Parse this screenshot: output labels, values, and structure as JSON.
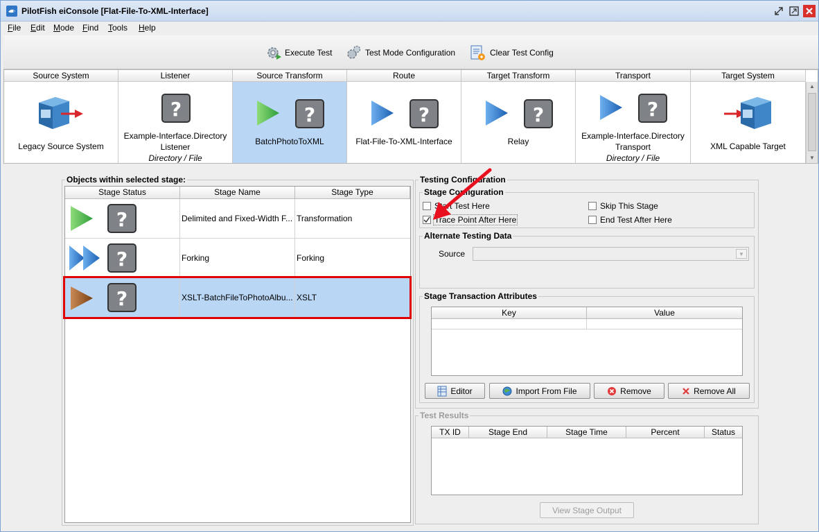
{
  "window": {
    "title": "PilotFish eiConsole [Flat-File-To-XML-Interface]"
  },
  "menu": [
    {
      "label": "File",
      "mnemonic": "F",
      "rest": "ile"
    },
    {
      "label": "Edit",
      "mnemonic": "E",
      "rest": "dit"
    },
    {
      "label": "Mode",
      "mnemonic": "M",
      "rest": "ode"
    },
    {
      "label": "Find",
      "mnemonic": "F",
      "rest": "ind"
    },
    {
      "label": "Tools",
      "mnemonic": "T",
      "rest": "ools"
    },
    {
      "label": "Help",
      "mnemonic": "H",
      "rest": "elp"
    }
  ],
  "toolbar": {
    "execute_test": "Execute Test",
    "test_mode_config": "Test Mode Configuration",
    "clear_test_config": "Clear Test Config"
  },
  "stages": {
    "headers": [
      "Source System",
      "Listener",
      "Source Transform",
      "Route",
      "Target Transform",
      "Transport",
      "Target System"
    ],
    "source_system": {
      "label": "Legacy Source System"
    },
    "listener": {
      "label1": "Example-Interface.Directory",
      "label2": "Listener",
      "label3": "Directory / File"
    },
    "source_transform": {
      "label": "BatchPhotoToXML"
    },
    "route": {
      "label": "Flat-File-To-XML-Interface"
    },
    "target_transform": {
      "label": "Relay"
    },
    "transport": {
      "label1": "Example-Interface.Directory",
      "label2": "Transport",
      "label3": "Directory / File"
    },
    "target_system": {
      "label": "XML Capable Target"
    }
  },
  "objects": {
    "title": "Objects within selected stage:",
    "columns": [
      "Stage Status",
      "Stage Name",
      "Stage Type"
    ],
    "rows": [
      {
        "name": "Delimited and Fixed-Width F...",
        "type": "Transformation"
      },
      {
        "name": "Forking",
        "type": "Forking"
      },
      {
        "name": "XSLT-BatchFileToPhotoAlbu...",
        "type": "XSLT"
      }
    ]
  },
  "testing": {
    "title": "Testing Configuration",
    "stage_config": {
      "title": "Stage Configuration",
      "start_test_here": "Start Test Here",
      "skip_this_stage": "Skip This Stage",
      "trace_point_after_here": "Trace Point After Here",
      "end_test_after_here": "End Test After Here"
    },
    "alt_data": {
      "title": "Alternate Testing Data",
      "source_label": "Source"
    },
    "attributes": {
      "title": "Stage Transaction Attributes",
      "columns": [
        "Key",
        "Value"
      ],
      "buttons": {
        "editor": "Editor",
        "import": "Import From File",
        "remove": "Remove",
        "remove_all": "Remove All"
      }
    },
    "results": {
      "title": "Test Results",
      "columns": [
        "TX ID",
        "Stage End",
        "Stage Time",
        "Percent",
        "Status"
      ],
      "view_output": "View Stage Output"
    }
  },
  "colors": {
    "highlight": "#e00000",
    "selection": "#b9d6f5",
    "arrow_red": "#e8101f"
  }
}
